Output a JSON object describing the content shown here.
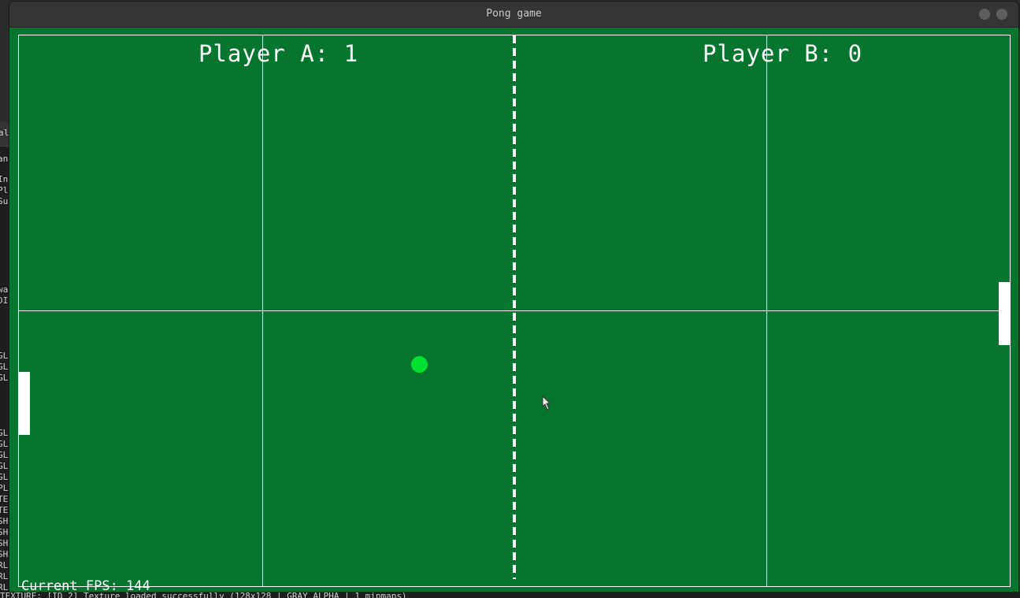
{
  "window": {
    "title": "Pong game"
  },
  "game": {
    "score_a": "Player A: 1",
    "score_b": "Player B: 0",
    "fps_text": "Current FPS: 144",
    "colors": {
      "field": "#077530",
      "ball": "#00e033",
      "lines": "#ffffff"
    }
  },
  "background_terminal": {
    "tab_label": "al",
    "lines": [
      "an",
      "In",
      "Pl",
      "Su",
      "wa",
      "DI",
      "GL",
      "GL",
      "GL",
      "GL",
      "GL",
      "GL",
      "GL",
      "GL",
      "PL",
      "TE",
      "TE",
      "SH",
      "SH",
      "SH",
      "SH",
      "RL",
      "RL",
      "RL"
    ],
    "bottom_log": "TEXTURE: [ID 2] Texture loaded successfully (128x128 | GRAY_ALPHA | 1 mipmaps)"
  }
}
